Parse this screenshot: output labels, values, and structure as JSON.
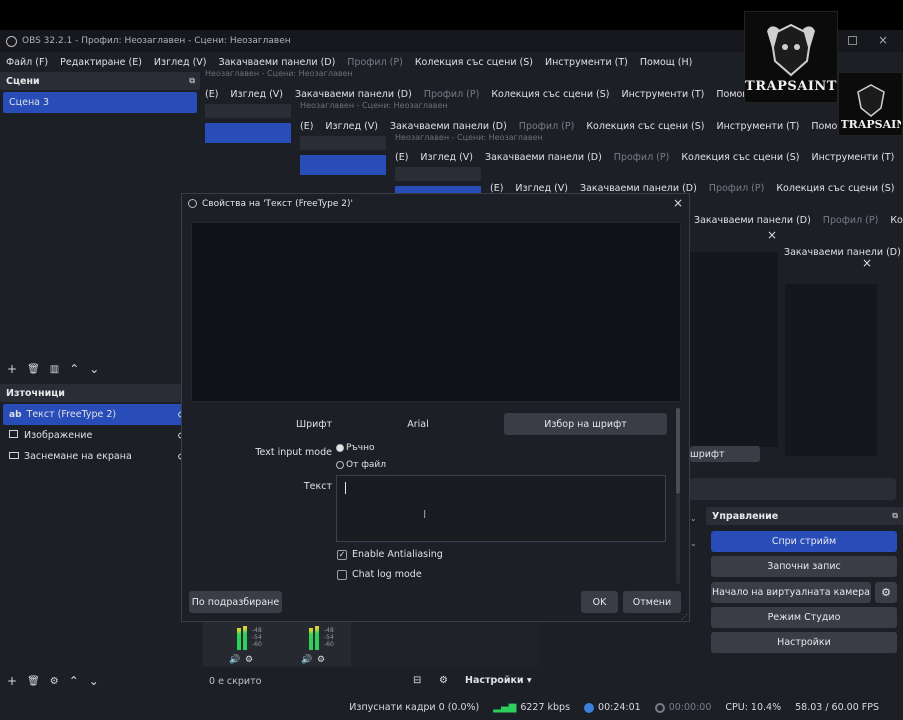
{
  "window": {
    "title": "OBS 32.2.1 - Профил: Неозаглавен - Сцени: Неозаглавен"
  },
  "menu": [
    "Файл (F)",
    "Редактиране (E)",
    "Изглед (V)",
    "Закачваеми панели (D)",
    "Профил (P)",
    "Колекция със сцени (S)",
    "Инструменти (T)",
    "Помощ (H)"
  ],
  "ghost_menu": [
    "(E)",
    "Изглед (V)",
    "Закачваеми панели (D)",
    "Профил (P)",
    "Колекция със сцени (S)",
    "Инструменти (T)",
    "Помощ (H)"
  ],
  "ghost_subtitle": "Неозаглавен - Сцени: Неозаглавен",
  "scenes": {
    "header": "Сцени",
    "items": [
      "Сцена 3"
    ]
  },
  "sources": {
    "header": "Източници",
    "items": [
      {
        "icon": "ab",
        "label": "Текст (FreeType 2)"
      },
      {
        "icon": "image-icon",
        "label": "Изображение"
      },
      {
        "icon": "monitor-icon",
        "label": "Заснемане на екрана"
      }
    ]
  },
  "dialog": {
    "title": "Свойства на 'Текст (FreeType 2)'",
    "font_label": "Шрифт",
    "font_value": "Arial",
    "font_button": "Избор на шрифт",
    "mode_label": "Text input mode",
    "mode_options": [
      "Ръчно",
      "От файл"
    ],
    "text_label": "Текст",
    "text_value": "",
    "antialias_label": "Enable Antialiasing",
    "chatlog_label": "Chat log mode",
    "defaults_button": "По подразбиране",
    "ok_button": "OK",
    "cancel_button": "Отмени"
  },
  "ghost_font_button": "шрифт",
  "mixer": {
    "ticks": [
      "-48",
      "-54",
      "-60"
    ],
    "hidden_count": "0 е скрито",
    "settings_label": "Настройки"
  },
  "controls": {
    "header": "Управление",
    "buttons": [
      "Спри стрийм",
      "Започни запис",
      "Начало на виртуалната камера",
      "Режим Студио",
      "Настройки"
    ]
  },
  "status": {
    "dropped": "Изпуснати кадри 0 (0.0%)",
    "bitrate": "6227 kbps",
    "stream_time": "00:24:01",
    "rec_time": "00:00:00",
    "cpu": "CPU: 10.4%",
    "fps": "58.03 / 60.00 FPS"
  },
  "logo": {
    "text": "TRAPSAINT"
  },
  "colors": {
    "accent": "#284cb8",
    "bitrate_green": "#2bd15a",
    "live_blue": "#3d7ddc"
  }
}
